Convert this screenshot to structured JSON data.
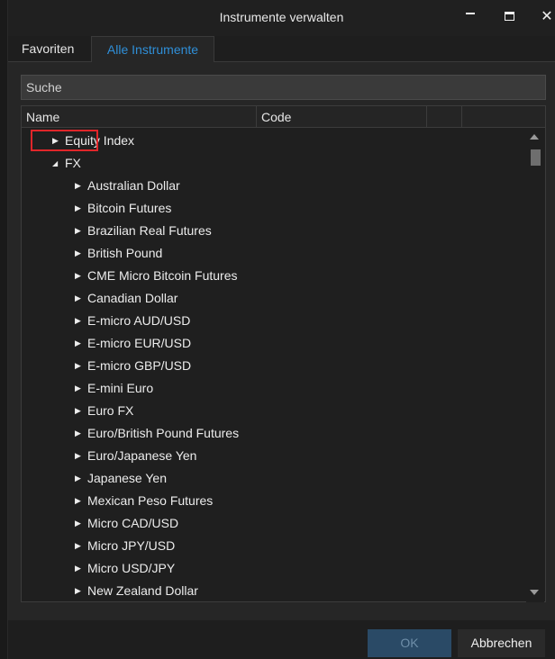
{
  "window": {
    "title": "Instrumente verwalten"
  },
  "tabs": [
    {
      "label": "Favoriten",
      "active": false
    },
    {
      "label": "Alle Instrumente",
      "active": true
    }
  ],
  "search": {
    "placeholder": "Suche",
    "value": ""
  },
  "columns": {
    "name": "Name",
    "code": "Code"
  },
  "tree": [
    {
      "label": "Equity Index",
      "level": 0,
      "expanded": false
    },
    {
      "label": "FX",
      "level": 0,
      "expanded": true,
      "highlighted": true
    },
    {
      "label": "Australian Dollar",
      "level": 1,
      "expanded": false
    },
    {
      "label": "Bitcoin Futures",
      "level": 1,
      "expanded": false
    },
    {
      "label": "Brazilian Real Futures",
      "level": 1,
      "expanded": false
    },
    {
      "label": "British Pound",
      "level": 1,
      "expanded": false
    },
    {
      "label": "CME Micro Bitcoin Futures",
      "level": 1,
      "expanded": false
    },
    {
      "label": "Canadian Dollar",
      "level": 1,
      "expanded": false
    },
    {
      "label": "E-micro AUD/USD",
      "level": 1,
      "expanded": false
    },
    {
      "label": "E-micro EUR/USD",
      "level": 1,
      "expanded": false
    },
    {
      "label": "E-micro GBP/USD",
      "level": 1,
      "expanded": false
    },
    {
      "label": "E-mini Euro",
      "level": 1,
      "expanded": false
    },
    {
      "label": "Euro FX",
      "level": 1,
      "expanded": false
    },
    {
      "label": "Euro/British Pound Futures",
      "level": 1,
      "expanded": false
    },
    {
      "label": "Euro/Japanese Yen",
      "level": 1,
      "expanded": false
    },
    {
      "label": "Japanese Yen",
      "level": 1,
      "expanded": false
    },
    {
      "label": "Mexican Peso Futures",
      "level": 1,
      "expanded": false
    },
    {
      "label": "Micro CAD/USD",
      "level": 1,
      "expanded": false
    },
    {
      "label": "Micro JPY/USD",
      "level": 1,
      "expanded": false
    },
    {
      "label": "Micro USD/JPY",
      "level": 1,
      "expanded": false
    },
    {
      "label": "New Zealand Dollar",
      "level": 1,
      "expanded": false
    }
  ],
  "buttons": {
    "ok": "OK",
    "cancel": "Abbrechen"
  },
  "colors": {
    "accent": "#2f8fd8",
    "highlight": "#e0262a",
    "ok_bg": "#2a4a66"
  }
}
